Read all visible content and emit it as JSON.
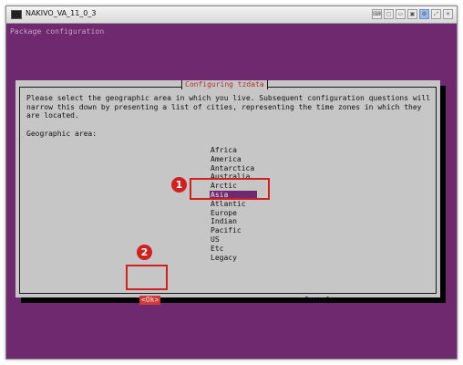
{
  "window": {
    "title": "NAKIVO_VA_11_0_3",
    "toolbar_icons": [
      "ctrl-alt-del-icon",
      "screenshot-icon",
      "window-icon",
      "monitor-icon",
      "settings-icon",
      "fullscreen-icon",
      "close-icon"
    ]
  },
  "console": {
    "header": "Package configuration",
    "dialog": {
      "title": "Configuring tzdata",
      "text_lines": [
        "Please select the geographic area in which you live. Subsequent configuration questions will",
        "narrow this down by presenting a list of cities, representing the time zones in which they",
        "are located."
      ],
      "geo_label": "Geographic area:",
      "areas": [
        "Africa",
        "America",
        "Antarctica",
        "Australia",
        "Arctic",
        "Asia",
        "Atlantic",
        "Europe",
        "Indian",
        "Pacific",
        "US",
        "Etc",
        "Legacy"
      ],
      "selected_area": "Asia",
      "ok_label": "<Ok>",
      "cancel_label": "<Cancel>"
    }
  },
  "callouts": [
    {
      "number": "1"
    },
    {
      "number": "2"
    }
  ],
  "colors": {
    "terminal_background": "#6f2a6f",
    "dialog_background": "#c6c6c6",
    "selection": "#6f2a6f",
    "ok_highlight": "#d03a3a",
    "callout": "#d02020"
  }
}
